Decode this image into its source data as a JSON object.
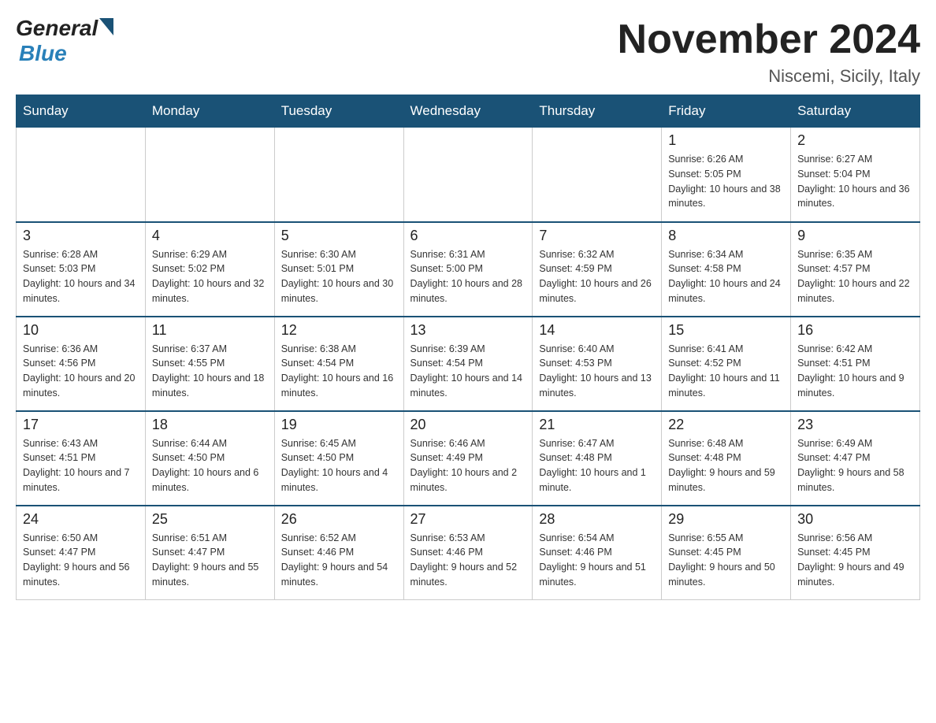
{
  "header": {
    "logo_general": "General",
    "logo_blue": "Blue",
    "month_title": "November 2024",
    "location": "Niscemi, Sicily, Italy"
  },
  "days_of_week": [
    "Sunday",
    "Monday",
    "Tuesday",
    "Wednesday",
    "Thursday",
    "Friday",
    "Saturday"
  ],
  "weeks": [
    [
      {
        "day": "",
        "info": ""
      },
      {
        "day": "",
        "info": ""
      },
      {
        "day": "",
        "info": ""
      },
      {
        "day": "",
        "info": ""
      },
      {
        "day": "",
        "info": ""
      },
      {
        "day": "1",
        "info": "Sunrise: 6:26 AM\nSunset: 5:05 PM\nDaylight: 10 hours and 38 minutes."
      },
      {
        "day": "2",
        "info": "Sunrise: 6:27 AM\nSunset: 5:04 PM\nDaylight: 10 hours and 36 minutes."
      }
    ],
    [
      {
        "day": "3",
        "info": "Sunrise: 6:28 AM\nSunset: 5:03 PM\nDaylight: 10 hours and 34 minutes."
      },
      {
        "day": "4",
        "info": "Sunrise: 6:29 AM\nSunset: 5:02 PM\nDaylight: 10 hours and 32 minutes."
      },
      {
        "day": "5",
        "info": "Sunrise: 6:30 AM\nSunset: 5:01 PM\nDaylight: 10 hours and 30 minutes."
      },
      {
        "day": "6",
        "info": "Sunrise: 6:31 AM\nSunset: 5:00 PM\nDaylight: 10 hours and 28 minutes."
      },
      {
        "day": "7",
        "info": "Sunrise: 6:32 AM\nSunset: 4:59 PM\nDaylight: 10 hours and 26 minutes."
      },
      {
        "day": "8",
        "info": "Sunrise: 6:34 AM\nSunset: 4:58 PM\nDaylight: 10 hours and 24 minutes."
      },
      {
        "day": "9",
        "info": "Sunrise: 6:35 AM\nSunset: 4:57 PM\nDaylight: 10 hours and 22 minutes."
      }
    ],
    [
      {
        "day": "10",
        "info": "Sunrise: 6:36 AM\nSunset: 4:56 PM\nDaylight: 10 hours and 20 minutes."
      },
      {
        "day": "11",
        "info": "Sunrise: 6:37 AM\nSunset: 4:55 PM\nDaylight: 10 hours and 18 minutes."
      },
      {
        "day": "12",
        "info": "Sunrise: 6:38 AM\nSunset: 4:54 PM\nDaylight: 10 hours and 16 minutes."
      },
      {
        "day": "13",
        "info": "Sunrise: 6:39 AM\nSunset: 4:54 PM\nDaylight: 10 hours and 14 minutes."
      },
      {
        "day": "14",
        "info": "Sunrise: 6:40 AM\nSunset: 4:53 PM\nDaylight: 10 hours and 13 minutes."
      },
      {
        "day": "15",
        "info": "Sunrise: 6:41 AM\nSunset: 4:52 PM\nDaylight: 10 hours and 11 minutes."
      },
      {
        "day": "16",
        "info": "Sunrise: 6:42 AM\nSunset: 4:51 PM\nDaylight: 10 hours and 9 minutes."
      }
    ],
    [
      {
        "day": "17",
        "info": "Sunrise: 6:43 AM\nSunset: 4:51 PM\nDaylight: 10 hours and 7 minutes."
      },
      {
        "day": "18",
        "info": "Sunrise: 6:44 AM\nSunset: 4:50 PM\nDaylight: 10 hours and 6 minutes."
      },
      {
        "day": "19",
        "info": "Sunrise: 6:45 AM\nSunset: 4:50 PM\nDaylight: 10 hours and 4 minutes."
      },
      {
        "day": "20",
        "info": "Sunrise: 6:46 AM\nSunset: 4:49 PM\nDaylight: 10 hours and 2 minutes."
      },
      {
        "day": "21",
        "info": "Sunrise: 6:47 AM\nSunset: 4:48 PM\nDaylight: 10 hours and 1 minute."
      },
      {
        "day": "22",
        "info": "Sunrise: 6:48 AM\nSunset: 4:48 PM\nDaylight: 9 hours and 59 minutes."
      },
      {
        "day": "23",
        "info": "Sunrise: 6:49 AM\nSunset: 4:47 PM\nDaylight: 9 hours and 58 minutes."
      }
    ],
    [
      {
        "day": "24",
        "info": "Sunrise: 6:50 AM\nSunset: 4:47 PM\nDaylight: 9 hours and 56 minutes."
      },
      {
        "day": "25",
        "info": "Sunrise: 6:51 AM\nSunset: 4:47 PM\nDaylight: 9 hours and 55 minutes."
      },
      {
        "day": "26",
        "info": "Sunrise: 6:52 AM\nSunset: 4:46 PM\nDaylight: 9 hours and 54 minutes."
      },
      {
        "day": "27",
        "info": "Sunrise: 6:53 AM\nSunset: 4:46 PM\nDaylight: 9 hours and 52 minutes."
      },
      {
        "day": "28",
        "info": "Sunrise: 6:54 AM\nSunset: 4:46 PM\nDaylight: 9 hours and 51 minutes."
      },
      {
        "day": "29",
        "info": "Sunrise: 6:55 AM\nSunset: 4:45 PM\nDaylight: 9 hours and 50 minutes."
      },
      {
        "day": "30",
        "info": "Sunrise: 6:56 AM\nSunset: 4:45 PM\nDaylight: 9 hours and 49 minutes."
      }
    ]
  ],
  "colors": {
    "header_bg": "#1a5276",
    "header_text": "#ffffff",
    "border": "#cccccc",
    "accent": "#2980b9"
  }
}
